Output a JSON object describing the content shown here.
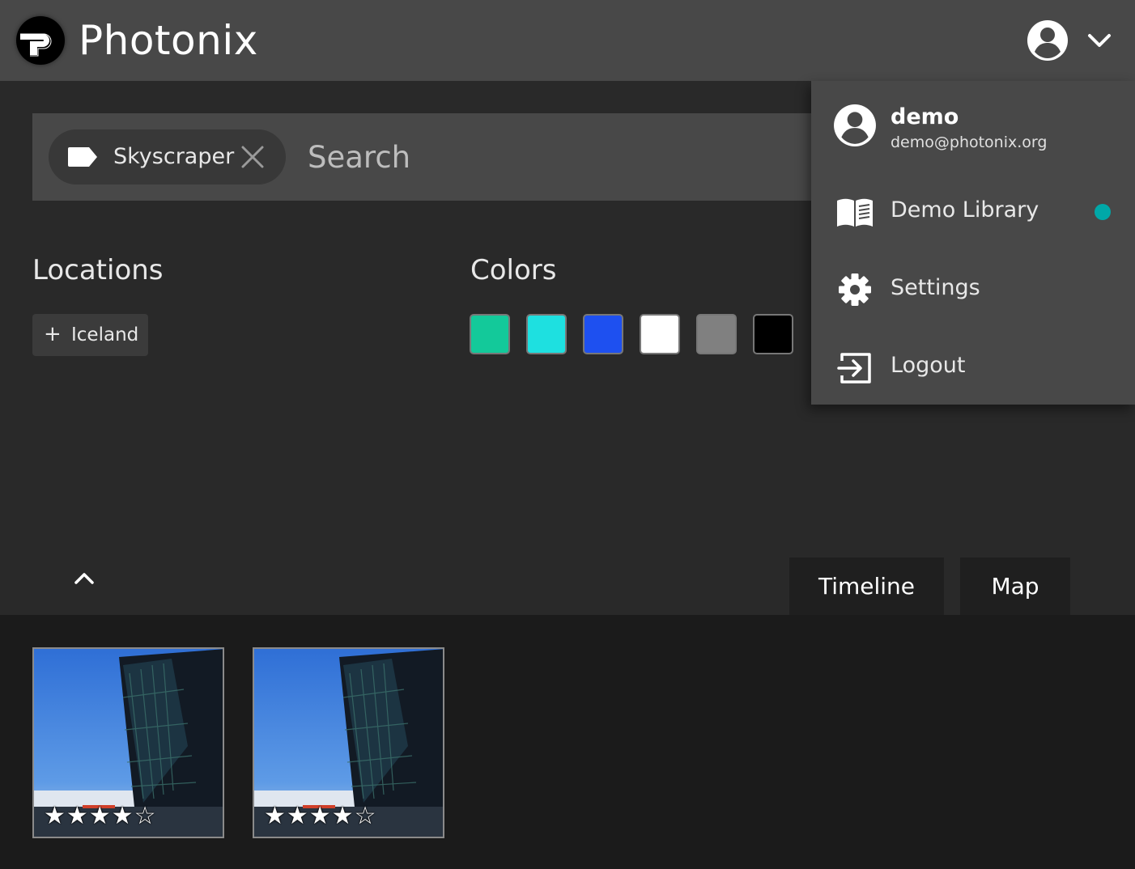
{
  "app": {
    "title": "Photonix"
  },
  "search": {
    "chip_label": "Skyscraper",
    "placeholder": "Search"
  },
  "filters": {
    "locations_title": "Locations",
    "location_items": [
      "Iceland"
    ],
    "colors_title": "Colors",
    "colors": [
      "#13c99a",
      "#1ee0e0",
      "#1e50f0",
      "#ffffff",
      "#808080",
      "#000000"
    ]
  },
  "tabs": {
    "timeline": "Timeline",
    "map": "Map"
  },
  "photos": [
    {
      "rating": 4,
      "max_rating": 5,
      "stars_text": "★★★★☆"
    },
    {
      "rating": 4,
      "max_rating": 5,
      "stars_text": "★★★★☆"
    }
  ],
  "menu": {
    "username": "demo",
    "email": "demo@photonix.org",
    "library": "Demo Library",
    "library_status_color": "#00a8a8",
    "settings": "Settings",
    "logout": "Logout"
  },
  "icons": [
    "photonix-logo-icon",
    "user-avatar-icon",
    "chevron-down-icon",
    "tag-icon",
    "close-icon",
    "plus-icon",
    "chevron-up-icon",
    "book-icon",
    "gear-icon",
    "logout-icon",
    "star-icon"
  ]
}
